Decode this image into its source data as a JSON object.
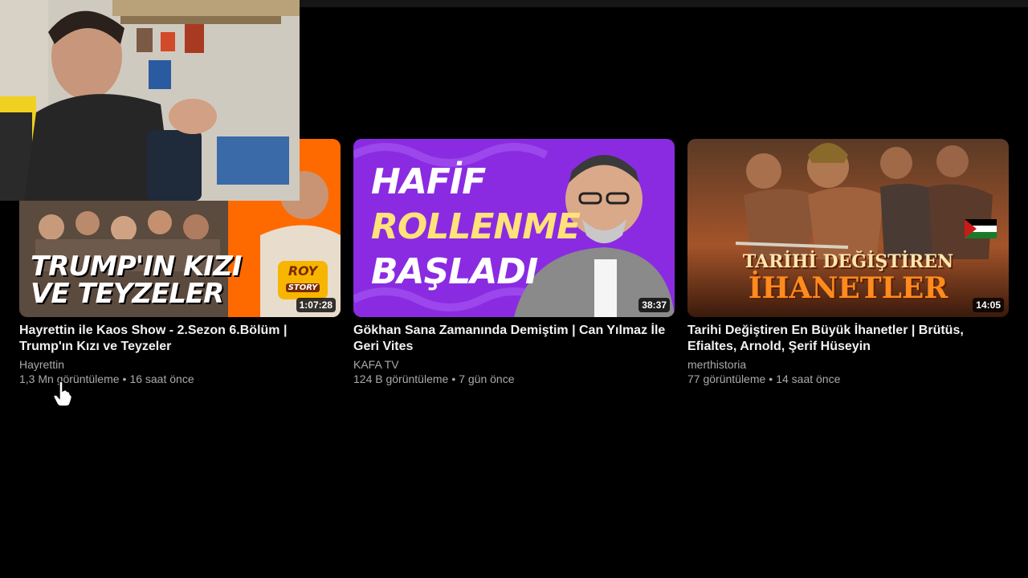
{
  "videos": [
    {
      "title": "Hayrettin ile Kaos Show - 2.Sezon 6.Bölüm | Trump'ın Kızı ve Teyzeler",
      "channel": "Hayrettin",
      "views": "1,3 Mn görüntüleme",
      "age": "16 saat önce",
      "duration": "1:07:28",
      "thumb_text_1": "TRUMP'IN KIZI",
      "thumb_text_2": "VE TEYZELER",
      "badge_text_1": "ROY",
      "badge_text_2": "STORY"
    },
    {
      "title": "Gökhan Sana Zamanında Demiştim | Can Yılmaz İle Geri Vites",
      "channel": "KAFA TV",
      "views": "124 B görüntüleme",
      "age": "7 gün önce",
      "duration": "38:37",
      "thumb_text_1": "HAFİF",
      "thumb_text_2": "ROLLENME",
      "thumb_text_3": "BAŞLADI"
    },
    {
      "title": "Tarihi Değiştiren En Büyük İhanetler | Brütüs, Efialtes, Arnold, Şerif Hüseyin",
      "channel": "merthistoria",
      "views": "77 görüntüleme",
      "age": "14 saat önce",
      "duration": "14:05",
      "thumb_text_1": "TARİHİ DEĞİŞTİREN",
      "thumb_text_2": "İHANETLER"
    }
  ],
  "separator": "•",
  "colors": {
    "background": "#000000",
    "title_text": "#f1f1f1",
    "secondary_text": "#aaaaaa",
    "thumb2_purple": "#8a2be2",
    "thumb1_orange": "#ff6a00"
  },
  "icons": [
    "hand-pointer-cursor-icon"
  ]
}
